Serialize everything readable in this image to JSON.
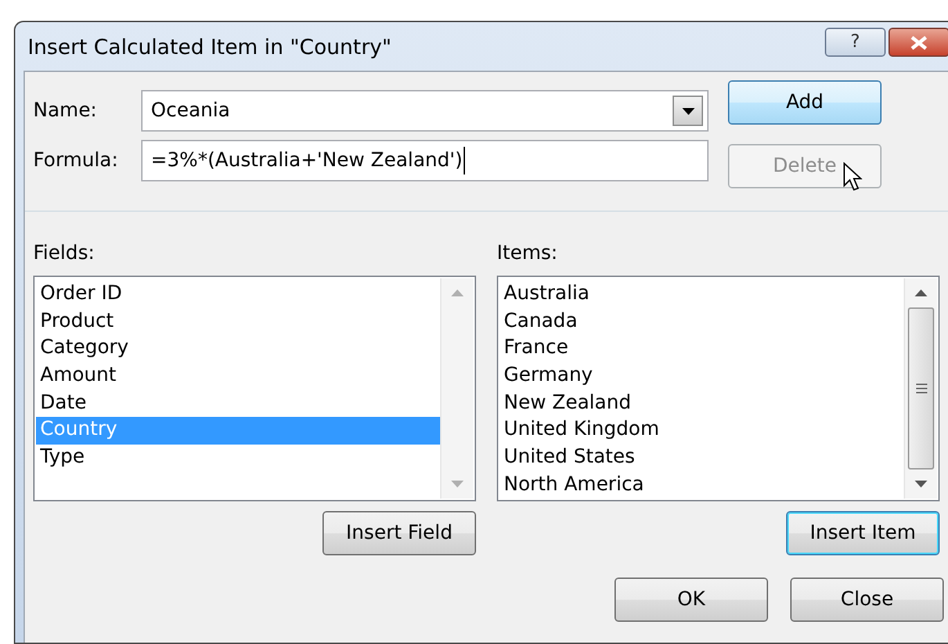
{
  "window": {
    "title": "Insert Calculated Item in \"Country\""
  },
  "title_buttons": [
    {
      "kind": "help",
      "label": "?"
    },
    {
      "kind": "close"
    }
  ],
  "name_field": {
    "label": "Name:",
    "value": "Oceania"
  },
  "formula_field": {
    "label": "Formula:",
    "value": "=3%*(Australia+'New Zealand')"
  },
  "side_buttons": [
    {
      "label": "Add",
      "disabled": false,
      "hovered": true
    },
    {
      "label": "Delete",
      "disabled": true,
      "hovered": false
    }
  ],
  "fields": {
    "label": "Fields:",
    "scrollable": false,
    "items": [
      {
        "label": "Order ID",
        "selected": false
      },
      {
        "label": "Product",
        "selected": false
      },
      {
        "label": "Category",
        "selected": false
      },
      {
        "label": "Amount",
        "selected": false
      },
      {
        "label": "Date",
        "selected": false
      },
      {
        "label": "Country",
        "selected": true
      },
      {
        "label": "Type",
        "selected": false
      }
    ],
    "button": {
      "label": "Insert Field",
      "focused": false
    }
  },
  "items": {
    "label": "Items:",
    "scrollable": true,
    "items": [
      {
        "label": "Australia",
        "selected": false
      },
      {
        "label": "Canada",
        "selected": false
      },
      {
        "label": "France",
        "selected": false
      },
      {
        "label": "Germany",
        "selected": false
      },
      {
        "label": "New Zealand",
        "selected": false
      },
      {
        "label": "United Kingdom",
        "selected": false
      },
      {
        "label": "United States",
        "selected": false
      },
      {
        "label": "North America",
        "selected": false
      }
    ],
    "button": {
      "label": "Insert Item",
      "focused": true
    }
  },
  "footer_buttons": [
    {
      "label": "OK"
    },
    {
      "label": "Close"
    }
  ]
}
